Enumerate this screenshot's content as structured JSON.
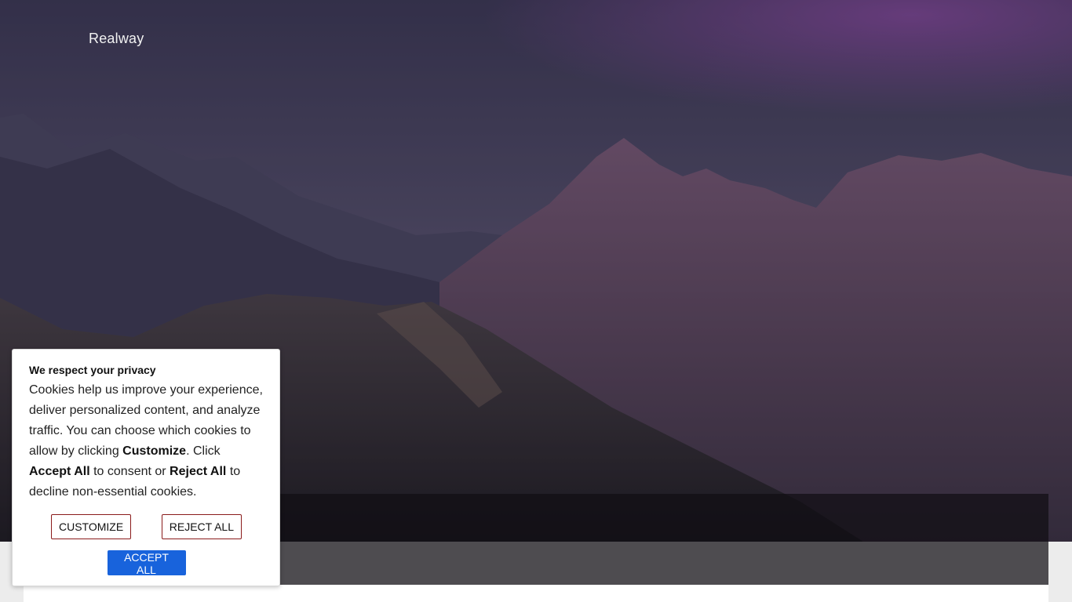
{
  "header": {
    "brand": "Realway"
  },
  "cookie_banner": {
    "title": "We respect your privacy",
    "text_1": "Cookies help us improve your experience, deliver personalized content, and analyze traffic. You can choose which cookies to allow by clicking ",
    "bold_customize": "Customize",
    "text_2": ". Click ",
    "bold_accept": "Accept All",
    "text_3": " to consent or ",
    "bold_reject": "Reject All",
    "text_4": " to decline non-essential cookies.",
    "customize_label": "CUSTOMIZE",
    "reject_label": "REJECT ALL",
    "accept_label": "ACCEPT ALL"
  },
  "colors": {
    "accept_button": "#1863dc",
    "outline_border": "#8a1b1b"
  }
}
